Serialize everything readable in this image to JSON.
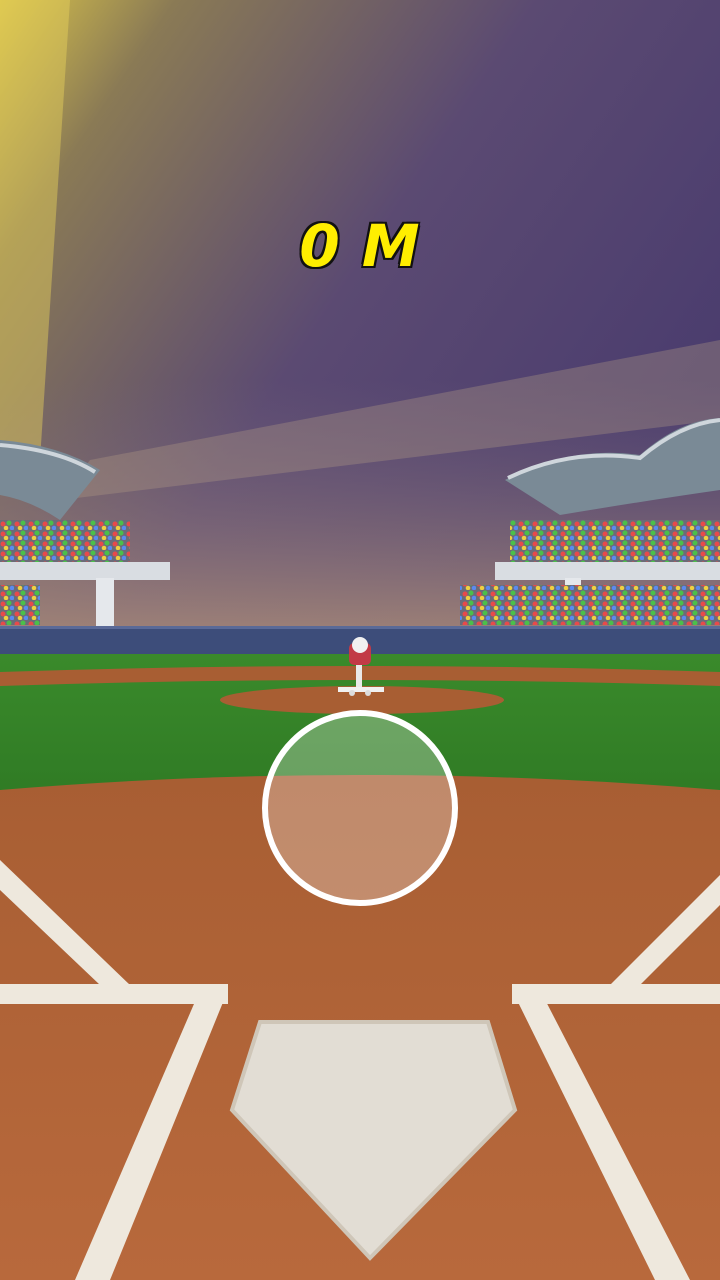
{
  "hud": {
    "distance_label": "0 M"
  },
  "colors": {
    "hud_text": "#ffee00",
    "grass": "#3f8f2e",
    "dirt": "#b8683a",
    "chalk": "#f3efe6"
  },
  "icons": {
    "aim_target": "aim-circle-icon",
    "pitcher": "pitching-machine-icon",
    "home_plate": "home-plate-icon"
  }
}
